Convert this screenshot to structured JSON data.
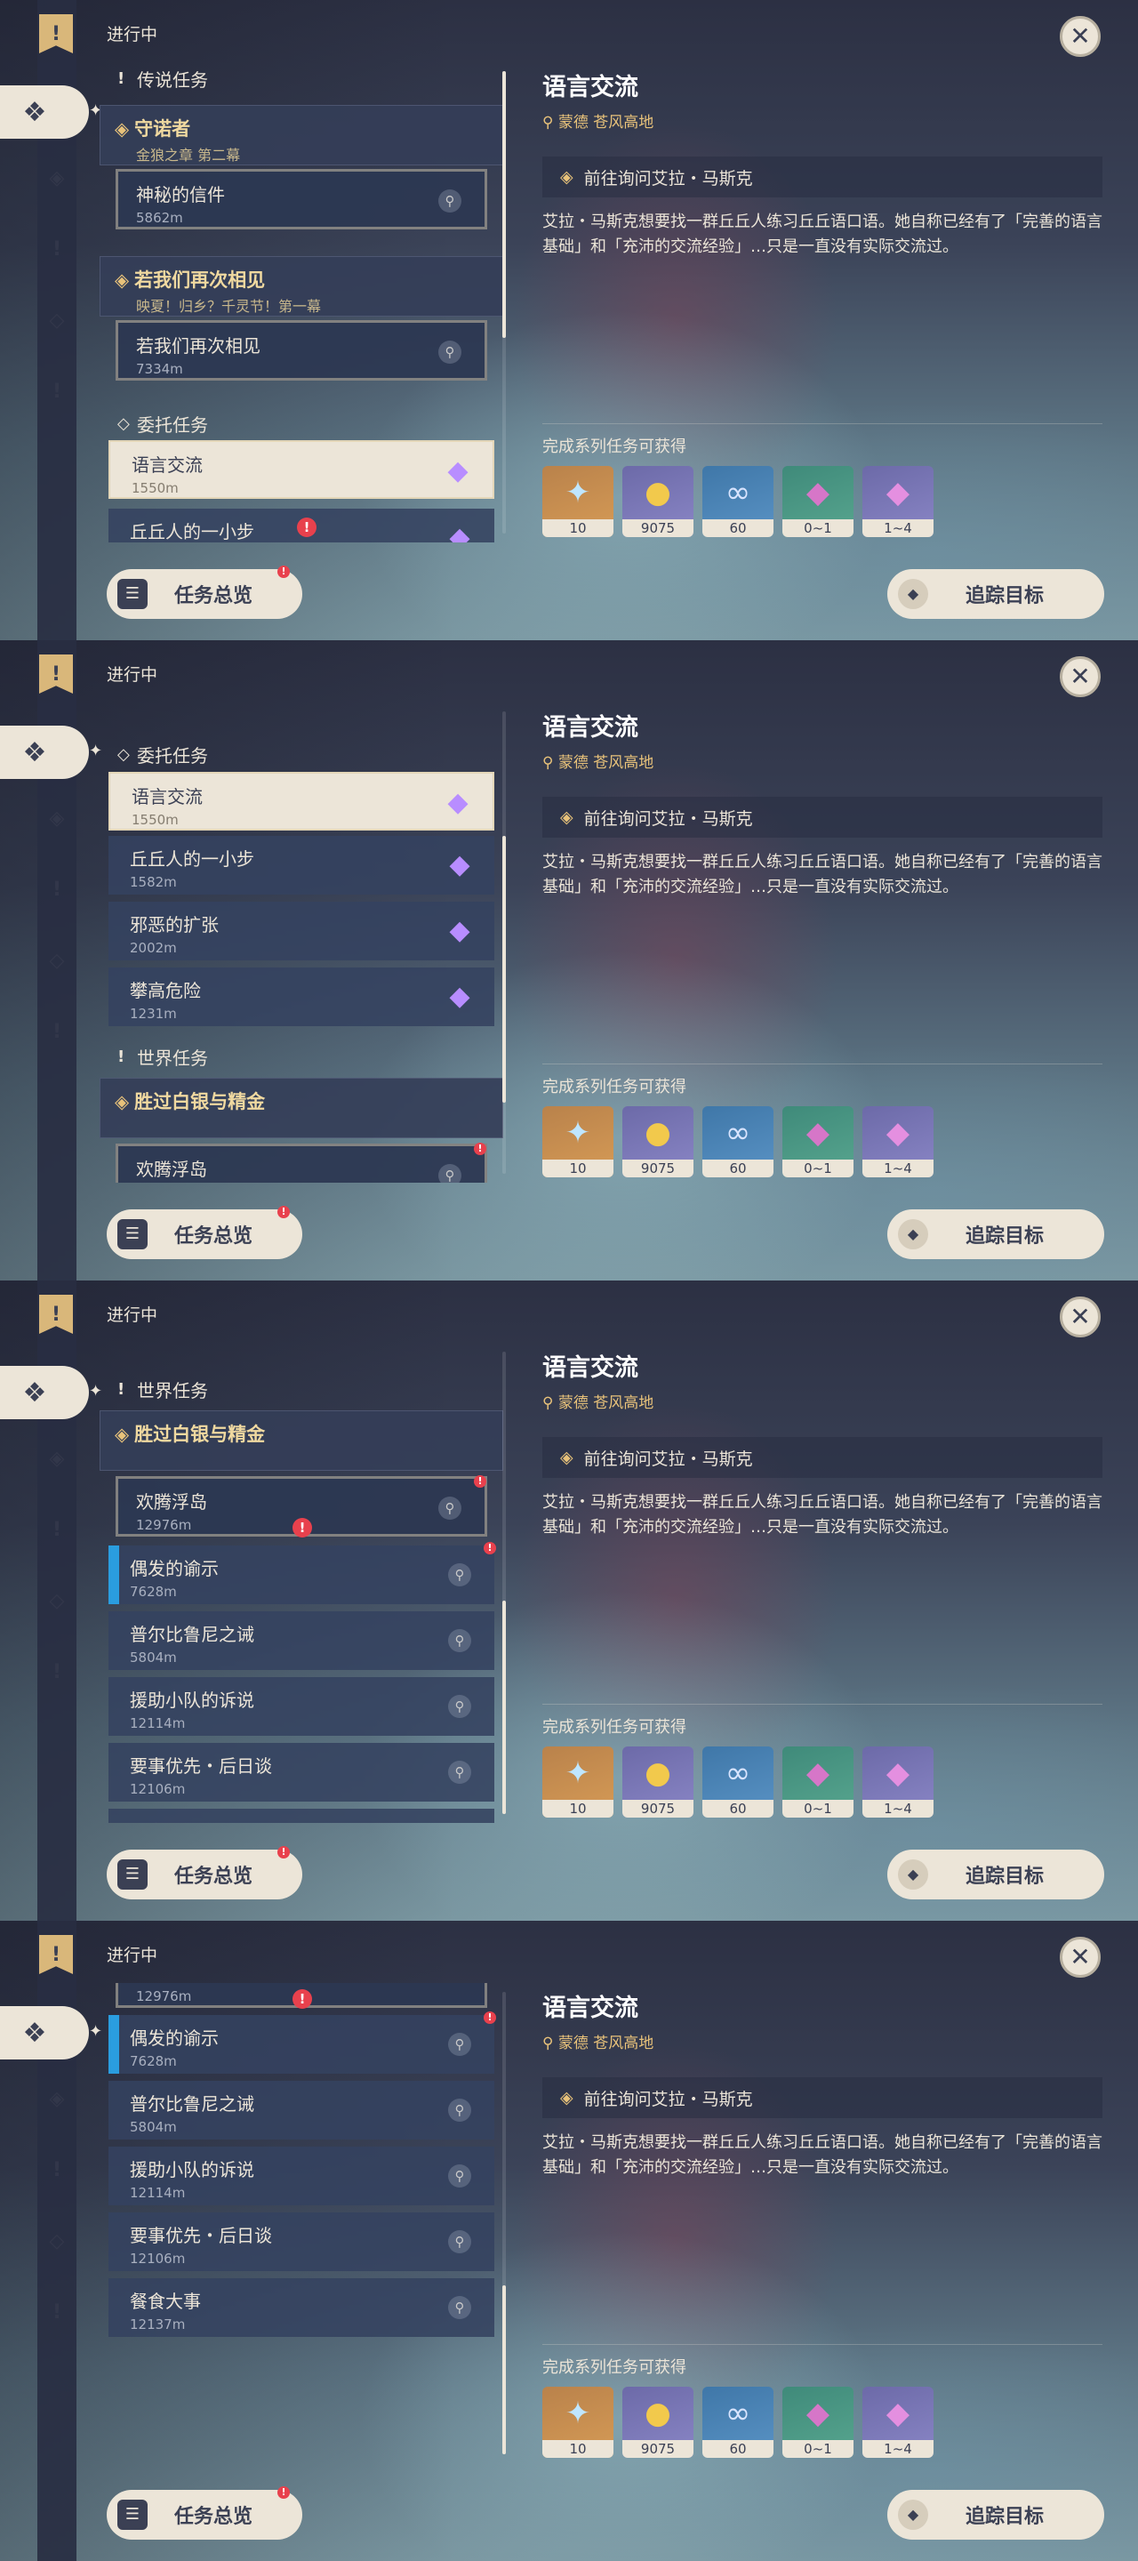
{
  "in_progress_label": "进行中",
  "rail": {
    "icons": [
      "quest-book-icon",
      "all-quests-icon",
      "archon-quest-icon",
      "story-quest-icon",
      "commission-icon",
      "world-quest-icon"
    ]
  },
  "sections": {
    "archon": "传说任务",
    "commission": "委托任务",
    "world": "世界任务"
  },
  "groups": {
    "guardian": {
      "title": "守诺者",
      "subtitle": "金狼之章 第二幕",
      "item_title": "神秘的信件",
      "item_dist": "5862m"
    },
    "meet_again": {
      "title": "若我们再次相见",
      "subtitle": "映夏！归乡？千灵节！第一幕",
      "item_title": "若我们再次相见",
      "item_dist": "7334m"
    },
    "silver": {
      "title": "胜过白银与精金",
      "item_title": "欢腾浮岛",
      "item_dist": "12976m"
    }
  },
  "commissions": [
    {
      "title": "语言交流",
      "dist": "1550m"
    },
    {
      "title": "丘丘人的一小步",
      "dist": "1582m"
    },
    {
      "title": "邪恶的扩张",
      "dist": "2002m"
    },
    {
      "title": "攀高危险",
      "dist": "1231m"
    }
  ],
  "world_items": [
    {
      "title": "偶发的谕示",
      "dist": "7628m"
    },
    {
      "title": "普尔比鲁尼之诫",
      "dist": "5804m"
    },
    {
      "title": "援助小队的诉说",
      "dist": "12114m"
    },
    {
      "title": "要事优先・后日谈",
      "dist": "12106m"
    },
    {
      "title": "餐食大事",
      "dist": "12137m"
    }
  ],
  "partial_text": {
    "next_item": "餐食大事"
  },
  "detail": {
    "title": "语言交流",
    "location": "蒙德 苍风高地",
    "objective": "前往询问艾拉・马斯克",
    "description": "艾拉・马斯克想要找一群丘丘人练习丘丘语口语。她自称已经有了「完善的语言基础」和「充沛的交流经验」…只是一直没有实际交流过。",
    "rewards_title": "完成系列任务可获得",
    "rewards": [
      {
        "icon": "adventure-exp-icon",
        "count": "10",
        "bg": "gold"
      },
      {
        "icon": "mora-icon",
        "count": "9075",
        "bg": "purple"
      },
      {
        "icon": "companionship-exp-icon",
        "count": "60",
        "bg": "blue"
      },
      {
        "icon": "crystal-green-icon",
        "count": "0~1",
        "bg": "green"
      },
      {
        "icon": "crystal-purple-icon",
        "count": "1~4",
        "bg": "purple"
      }
    ]
  },
  "buttons": {
    "overview": "任务总览",
    "track": "追踪目标",
    "close": "✕"
  },
  "colors": {
    "accent": "#ece5d8",
    "gold": "#e8c27a",
    "alert": "#e8414d",
    "rail": "#282e42",
    "marker_blue": "#2a9ddf"
  }
}
